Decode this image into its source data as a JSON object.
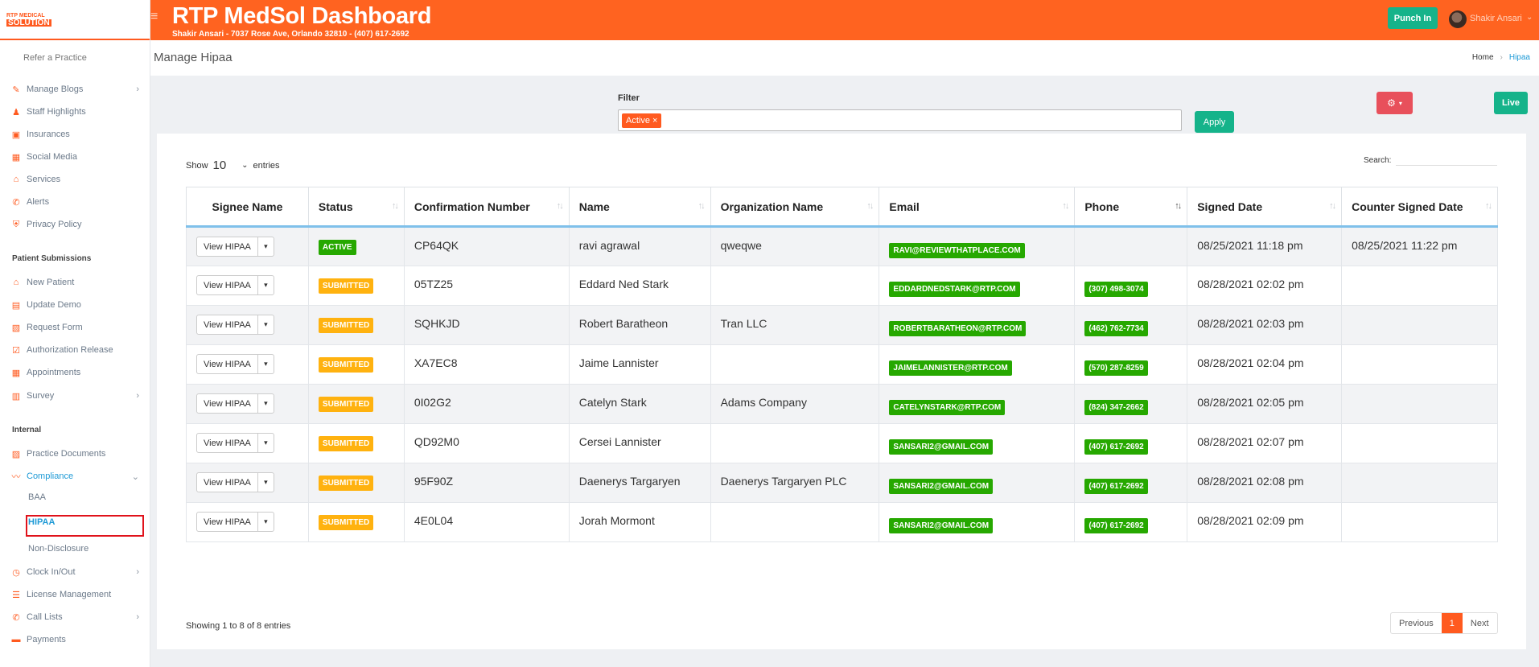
{
  "logo": {
    "top": "RTP MEDICAL",
    "bottom": "SOLUTION"
  },
  "header": {
    "title": "RTP MedSol Dashboard",
    "subtitle": "Shakir Ansari - 7037 Rose Ave, Orlando 32810 - (407) 617-2692",
    "punch_label": "Punch In",
    "user_name": "Shakir Ansari"
  },
  "sidebar": {
    "refer": "Refer a Practice",
    "items1": [
      {
        "label": "Manage Blogs",
        "icon": "blog-icon"
      },
      {
        "label": "Staff Highlights",
        "icon": "user-icon"
      },
      {
        "label": "Insurances",
        "icon": "briefcase-icon"
      },
      {
        "label": "Social Media",
        "icon": "social-icon"
      },
      {
        "label": "Services",
        "icon": "services-icon"
      },
      {
        "label": "Alerts",
        "icon": "phone-icon"
      },
      {
        "label": "Privacy Policy",
        "icon": "shield-icon"
      }
    ],
    "section1": "Patient Submissions",
    "items2": [
      {
        "label": "New Patient",
        "icon": "home-icon"
      },
      {
        "label": "Update Demo",
        "icon": "idcard-icon"
      },
      {
        "label": "Request Form",
        "icon": "file-icon"
      },
      {
        "label": "Authorization Release",
        "icon": "check-icon"
      },
      {
        "label": "Appointments",
        "icon": "calendar-icon"
      },
      {
        "label": "Survey",
        "icon": "survey-icon"
      }
    ],
    "section2": "Internal",
    "items3": [
      {
        "label": "Practice Documents",
        "icon": "clipboard-icon"
      },
      {
        "label": "Compliance",
        "icon": "signature-icon"
      }
    ],
    "compliance_sub": [
      "BAA",
      "HIPAA",
      "Non-Disclosure"
    ],
    "items4": [
      {
        "label": "Clock In/Out",
        "icon": "clock-icon"
      },
      {
        "label": "License Management",
        "icon": "list-icon"
      },
      {
        "label": "Call Lists",
        "icon": "phone-icon"
      },
      {
        "label": "Payments",
        "icon": "money-icon"
      }
    ]
  },
  "page": {
    "title": "Manage Hipaa",
    "crumb_home": "Home",
    "crumb_current": "Hipaa"
  },
  "filter": {
    "label": "Filter",
    "tag": "Active",
    "tag_remove": "×",
    "apply": "Apply",
    "live": "Live"
  },
  "table": {
    "show_prefix": "Show",
    "show_value": "10",
    "show_suffix": "entries",
    "search_label": "Search:",
    "columns": [
      "Signee Name",
      "Status",
      "Confirmation Number",
      "Name",
      "Organization Name",
      "Email",
      "Phone",
      "Signed Date",
      "Counter Signed Date"
    ],
    "view_label": "View HIPAA",
    "rows": [
      {
        "status": "ACTIVE",
        "conf": "CP64QK",
        "name": "ravi agrawal",
        "org": "qweqwe",
        "email": "RAVI@REVIEWTHATPLACE.COM",
        "phone": "",
        "signed": "08/25/2021 11:18 pm",
        "counter": "08/25/2021 11:22 pm"
      },
      {
        "status": "SUBMITTED",
        "conf": "05TZ25",
        "name": "Eddard Ned Stark",
        "org": "",
        "email": "EDDARDNEDSTARK@RTP.COM",
        "phone": "(307) 498-3074",
        "signed": "08/28/2021 02:02 pm",
        "counter": ""
      },
      {
        "status": "SUBMITTED",
        "conf": "SQHKJD",
        "name": "Robert Baratheon",
        "org": "Tran LLC",
        "email": "ROBERTBARATHEON@RTP.COM",
        "phone": "(462) 762-7734",
        "signed": "08/28/2021 02:03 pm",
        "counter": ""
      },
      {
        "status": "SUBMITTED",
        "conf": "XA7EC8",
        "name": "Jaime Lannister",
        "org": "",
        "email": "JAIMELANNISTER@RTP.COM",
        "phone": "(570) 287-8259",
        "signed": "08/28/2021 02:04 pm",
        "counter": ""
      },
      {
        "status": "SUBMITTED",
        "conf": "0I02G2",
        "name": "Catelyn Stark",
        "org": "Adams Company",
        "email": "CATELYNSTARK@RTP.COM",
        "phone": "(824) 347-2662",
        "signed": "08/28/2021 02:05 pm",
        "counter": ""
      },
      {
        "status": "SUBMITTED",
        "conf": "QD92M0",
        "name": "Cersei Lannister",
        "org": "",
        "email": "SANSARI2@GMAIL.COM",
        "phone": "(407) 617-2692",
        "signed": "08/28/2021 02:07 pm",
        "counter": ""
      },
      {
        "status": "SUBMITTED",
        "conf": "95F90Z",
        "name": "Daenerys Targaryen",
        "org": "Daenerys Targaryen PLC",
        "email": "SANSARI2@GMAIL.COM",
        "phone": "(407) 617-2692",
        "signed": "08/28/2021 02:08 pm",
        "counter": ""
      },
      {
        "status": "SUBMITTED",
        "conf": "4E0L04",
        "name": "Jorah Mormont",
        "org": "",
        "email": "SANSARI2@GMAIL.COM",
        "phone": "(407) 617-2692",
        "signed": "08/28/2021 02:09 pm",
        "counter": ""
      }
    ],
    "info": "Showing 1 to 8 of 8 entries",
    "prev": "Previous",
    "page": "1",
    "next": "Next"
  }
}
